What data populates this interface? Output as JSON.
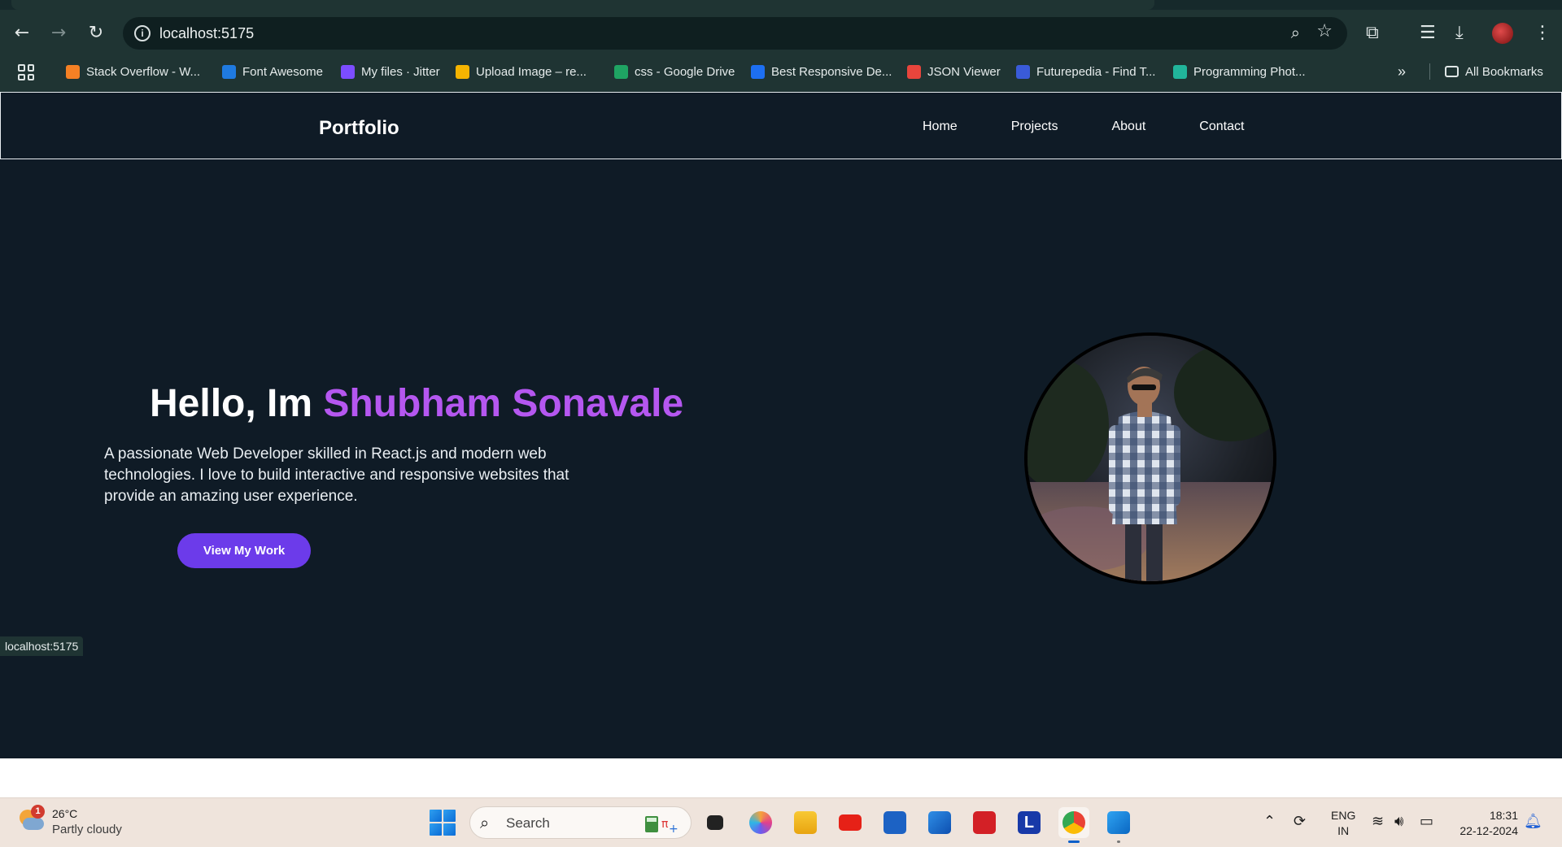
{
  "browser": {
    "url": "localhost:5175",
    "bookmarks": [
      {
        "label": "Stack Overflow - W...",
        "color": "#f48024"
      },
      {
        "label": "Font Awesome",
        "color": "#1f7ae0"
      },
      {
        "label": "My files · Jitter",
        "color": "#7c4dff"
      },
      {
        "label": "Upload Image – re...",
        "color": "#f5b400"
      },
      {
        "label": "css - Google Drive",
        "color": "#1fa463"
      },
      {
        "label": "Best Responsive De...",
        "color": "#1d6ff2"
      },
      {
        "label": "JSON Viewer",
        "color": "#e8453c"
      },
      {
        "label": "Futurepedia - Find T...",
        "color": "#3a5bd9"
      },
      {
        "label": "Programming Phot...",
        "color": "#21b59b"
      }
    ],
    "all_bookmarks_label": "All Bookmarks",
    "status_url": "localhost:5175"
  },
  "site": {
    "brand": "Portfolio",
    "nav": [
      "Home",
      "Projects",
      "About",
      "Contact"
    ],
    "hero": {
      "greeting": "Hello, Im ",
      "name": "Shubham Sonavale",
      "description": "A passionate Web Developer skilled in React.js and modern web technologies. I love to build interactive and responsive websites that provide an amazing user experience.",
      "cta_label": "View My Work"
    },
    "colors": {
      "background": "#0f1b26",
      "accent": "#b557f0",
      "button": "#6c3bea"
    }
  },
  "taskbar": {
    "weather": {
      "temp": "26°C",
      "condition": "Partly cloudy",
      "badge": "1"
    },
    "search_label": "Search",
    "lang_line1": "ENG",
    "lang_line2": "IN",
    "time": "18:31",
    "date": "22-12-2024"
  }
}
